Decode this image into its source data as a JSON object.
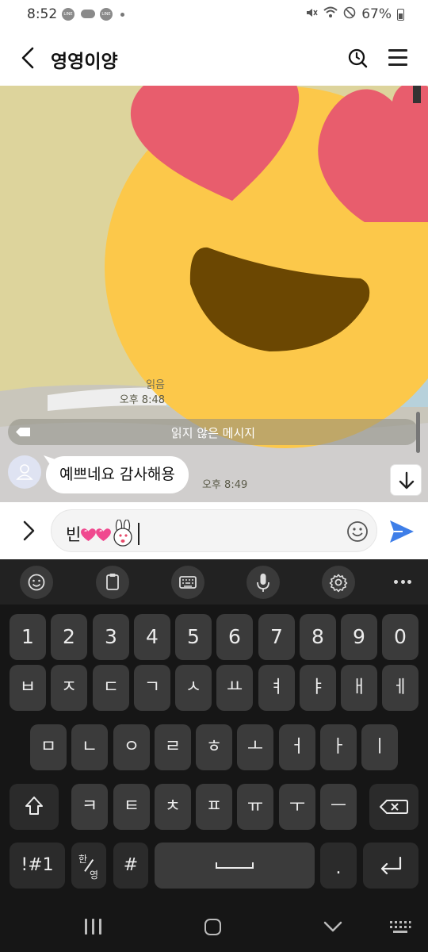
{
  "status_bar": {
    "time": "8:52",
    "notification_icons": [
      "LINE",
      "cloud",
      "LINE"
    ],
    "battery": "67%"
  },
  "header": {
    "title": "영영이양"
  },
  "chat": {
    "image_message": {
      "read_label": "읽음",
      "time": "오후 8:48"
    },
    "unread_divider": "읽지 않은 메시지",
    "received_message": {
      "text": "예쁘네요 감사해용",
      "time": "오후 8:49"
    }
  },
  "composer": {
    "text": "빈",
    "emoji_sequence": [
      "pink-heart",
      "pink-heart",
      "bunny-heart-eyes"
    ]
  },
  "keyboard": {
    "toolbar": [
      "emoji",
      "clipboard",
      "keyboard-mode",
      "voice-input",
      "settings",
      "more"
    ],
    "row_numbers": [
      "1",
      "2",
      "3",
      "4",
      "5",
      "6",
      "7",
      "8",
      "9",
      "0"
    ],
    "row_1": [
      "ㅂ",
      "ㅈ",
      "ㄷ",
      "ㄱ",
      "ㅅ",
      "ㅛ",
      "ㅕ",
      "ㅑ",
      "ㅐ",
      "ㅔ"
    ],
    "row_2": [
      "ㅁ",
      "ㄴ",
      "ㅇ",
      "ㄹ",
      "ㅎ",
      "ㅗ",
      "ㅓ",
      "ㅏ",
      "ㅣ"
    ],
    "row_3": [
      "ㅋ",
      "ㅌ",
      "ㅊ",
      "ㅍ",
      "ㅠ",
      "ㅜ",
      "ㅡ"
    ],
    "symbols_label": "!#1",
    "lang_top": "한",
    "lang_bottom": "영",
    "hash_label": "#",
    "period_label": "."
  },
  "colors": {
    "chat_background": "#ddd49c",
    "keyboard_background": "#161616",
    "key": "#3b3b3b",
    "send_accent": "#3e7ee8",
    "heart_red": "#e85d6d",
    "face_yellow": "#fcc84a"
  }
}
